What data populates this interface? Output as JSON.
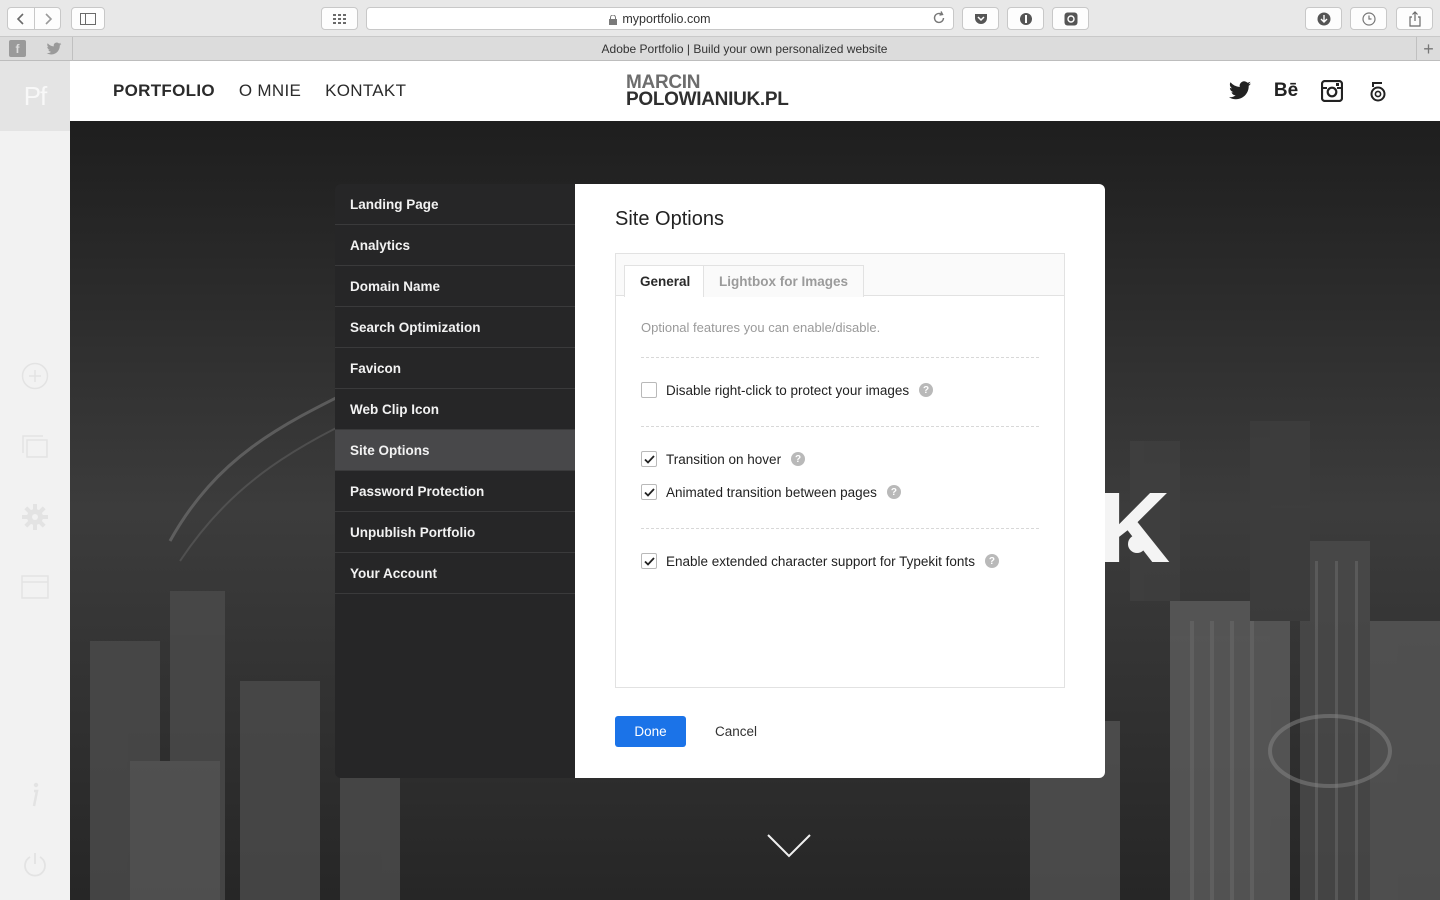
{
  "browser": {
    "address": "myportfolio.com",
    "tab_title": "Adobe Portfolio | Build your own personalized website"
  },
  "editor": {
    "logo": "Pf"
  },
  "site": {
    "nav": [
      "PORTFOLIO",
      "O MNIE",
      "KONTAKT"
    ],
    "brand_line1": "MARCIN",
    "brand_line2": "POLOWIANIUK.PL",
    "social_behance": "Bē"
  },
  "settings_menu": [
    "Landing Page",
    "Analytics",
    "Domain Name",
    "Search Optimization",
    "Favicon",
    "Web Clip Icon",
    "Site Options",
    "Password Protection",
    "Unpublish Portfolio",
    "Your Account"
  ],
  "dialog": {
    "title": "Site Options",
    "tabs": [
      "General",
      "Lightbox for Images"
    ],
    "description": "Optional features you can enable/disable.",
    "options": [
      {
        "label": "Disable right-click to protect your images",
        "checked": false
      },
      {
        "label": "Transition on hover",
        "checked": true
      },
      {
        "label": "Animated transition between pages",
        "checked": true
      },
      {
        "label": "Enable extended character support for Typekit fonts",
        "checked": true
      }
    ],
    "help_glyph": "?",
    "done_label": "Done",
    "cancel_label": "Cancel"
  },
  "colors": {
    "accent": "#1b73e8",
    "panel_dark": "#262627",
    "panel_active": "#48484a"
  }
}
